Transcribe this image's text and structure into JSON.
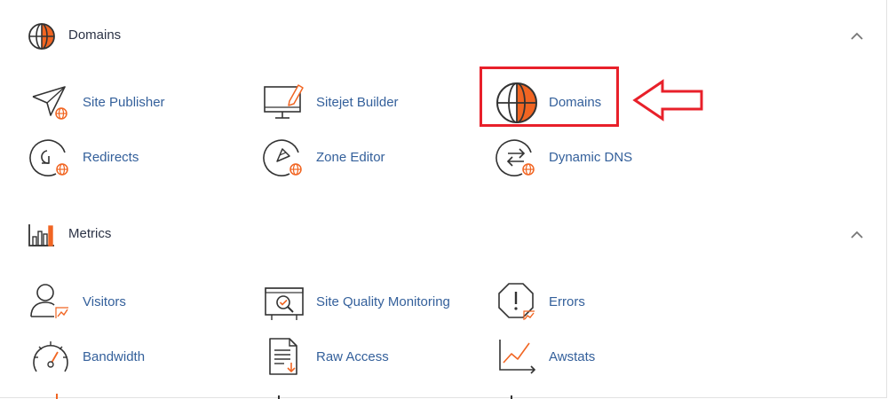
{
  "colors": {
    "accent": "#f16522",
    "link": "#34609b",
    "icon": "#333333",
    "highlight": "#e8202a"
  },
  "sections": [
    {
      "title": "Domains",
      "icon": "globe-icon",
      "items": [
        {
          "label": "Site Publisher",
          "icon": "paper-plane-globe-icon"
        },
        {
          "label": "Sitejet Builder",
          "icon": "monitor-pen-icon"
        },
        {
          "label": "Domains",
          "icon": "globe-icon"
        },
        {
          "label": "Redirects",
          "icon": "redirect-globe-icon"
        },
        {
          "label": "Zone Editor",
          "icon": "compass-globe-icon"
        },
        {
          "label": "Dynamic DNS",
          "icon": "arrows-exchange-globe-icon"
        }
      ]
    },
    {
      "title": "Metrics",
      "icon": "bar-chart-icon",
      "items": [
        {
          "label": "Visitors",
          "icon": "user-chart-icon"
        },
        {
          "label": "Site Quality Monitoring",
          "icon": "monitor-magnifier-icon"
        },
        {
          "label": "Errors",
          "icon": "octagon-alert-icon"
        },
        {
          "label": "Bandwidth",
          "icon": "gauge-icon"
        },
        {
          "label": "Raw Access",
          "icon": "document-download-icon"
        },
        {
          "label": "Awstats",
          "icon": "line-chart-icon"
        }
      ]
    }
  ]
}
